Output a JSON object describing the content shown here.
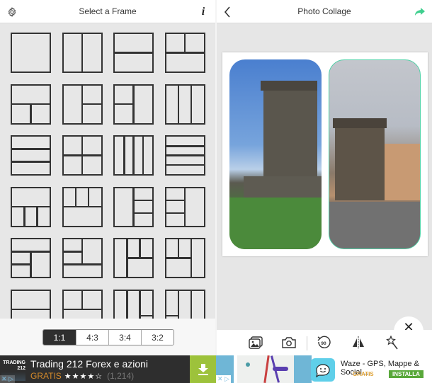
{
  "left_panel": {
    "title": "Select a Frame",
    "settings_icon": "gear-icon",
    "info_icon": "info-icon",
    "frames": [
      {
        "name": "single",
        "layout": "1"
      },
      {
        "name": "two-vertical",
        "layout": "2v"
      },
      {
        "name": "two-horizontal",
        "layout": "2h"
      },
      {
        "name": "two-top-one-bottom",
        "layout": "2t1b"
      },
      {
        "name": "one-top-two-bottom",
        "layout": "1t2b"
      },
      {
        "name": "one-left-two-right",
        "layout": "1l2r"
      },
      {
        "name": "two-left-one-right",
        "layout": "2l1r"
      },
      {
        "name": "three-vertical",
        "layout": "3v"
      },
      {
        "name": "three-horizontal",
        "layout": "3h"
      },
      {
        "name": "four-grid",
        "layout": "4g"
      },
      {
        "name": "four-vertical",
        "layout": "4v"
      },
      {
        "name": "four-horizontal",
        "layout": "4h"
      },
      {
        "name": "one-top-three-bottom",
        "layout": "1t3b"
      },
      {
        "name": "three-top-one-bottom",
        "layout": "3t1b"
      },
      {
        "name": "one-left-three-right",
        "layout": "1l3r"
      },
      {
        "name": "three-left-one-right",
        "layout": "3l1r"
      },
      {
        "name": "mixed-a",
        "layout": "ma"
      },
      {
        "name": "mixed-b",
        "layout": "mb"
      },
      {
        "name": "mixed-c",
        "layout": "mc"
      },
      {
        "name": "mixed-d",
        "layout": "md"
      },
      {
        "name": "two-horizontal-b",
        "layout": "2h"
      },
      {
        "name": "two-top-one-bottom-b",
        "layout": "2t1b"
      },
      {
        "name": "mixed-e",
        "layout": "me"
      },
      {
        "name": "mixed-f",
        "layout": "mf"
      }
    ],
    "ratios": [
      "1:1",
      "4:3",
      "3:4",
      "3:2"
    ],
    "selected_ratio": "1:1"
  },
  "right_panel": {
    "title": "Photo Collage",
    "back_icon": "chevron-left-icon",
    "share_icon": "share-arrow-icon",
    "accent_color": "#4fd1a6",
    "close_label": "✕",
    "tools": [
      "gallery-icon",
      "camera-icon",
      "rotate-90-icon",
      "flip-icon",
      "magic-wand-icon"
    ],
    "rotate_label": "90"
  },
  "ads": {
    "left": {
      "logo_text": "TRADING 212",
      "title": "Trading 212 Forex e azioni",
      "price": "GRATIS",
      "stars": "★★★★☆",
      "rating_count": "(1,214)",
      "cta_icon": "download-icon"
    },
    "right": {
      "title": "Waze - GPS, Mappe & Social ...",
      "price": "GRATIS",
      "cta": "INSTALLA"
    }
  }
}
